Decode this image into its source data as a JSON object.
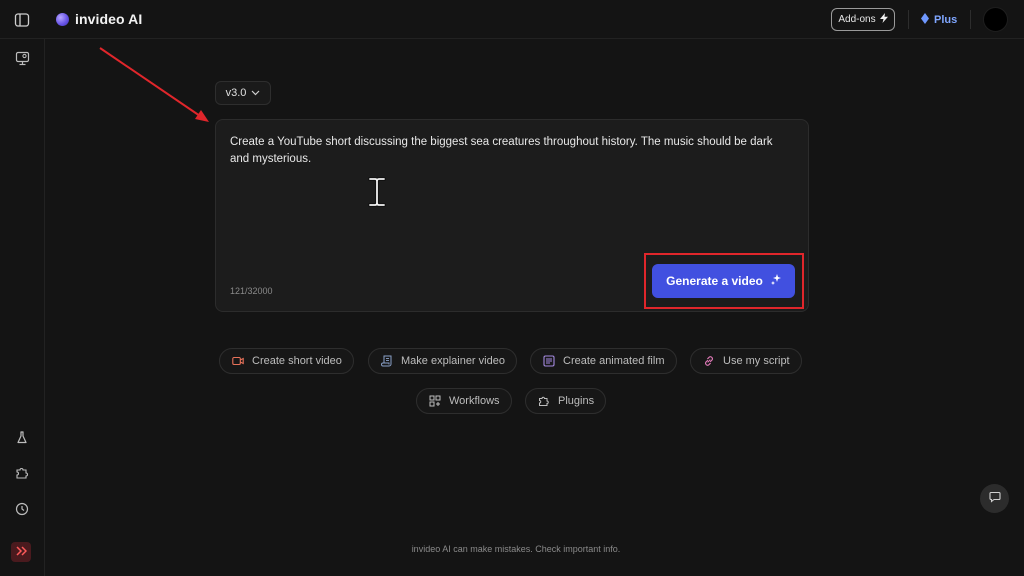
{
  "app": {
    "name": "invideo AI"
  },
  "header": {
    "addons_label": "Add-ons",
    "plus_label": "Plus"
  },
  "version": {
    "selected": "v3.0"
  },
  "prompt": {
    "text": "Create a YouTube short discussing the biggest sea creatures throughout history. The music should be dark and mysterious.",
    "char_count": "121/32000"
  },
  "generate": {
    "label": "Generate a video"
  },
  "chips": [
    {
      "label": "Create short video",
      "icon": "video-camera-icon",
      "color": "#e8725a"
    },
    {
      "label": "Make explainer video",
      "icon": "scroll-icon",
      "color": "#8aa0c8"
    },
    {
      "label": "Create animated film",
      "icon": "list-icon",
      "color": "#a58ae0"
    },
    {
      "label": "Use my script",
      "icon": "link-icon",
      "color": "#e07ab8"
    },
    {
      "label": "Workflows",
      "icon": "grid-icon",
      "color": "#bdbdbd"
    },
    {
      "label": "Plugins",
      "icon": "puzzle-icon",
      "color": "#bdbdbd"
    }
  ],
  "footer": {
    "disclaimer": "invideo AI can make mistakes. Check important info."
  },
  "colors": {
    "background": "#141414",
    "accent": "#4150e0",
    "annotation": "#e0262b",
    "plus": "#7fa6ff"
  }
}
